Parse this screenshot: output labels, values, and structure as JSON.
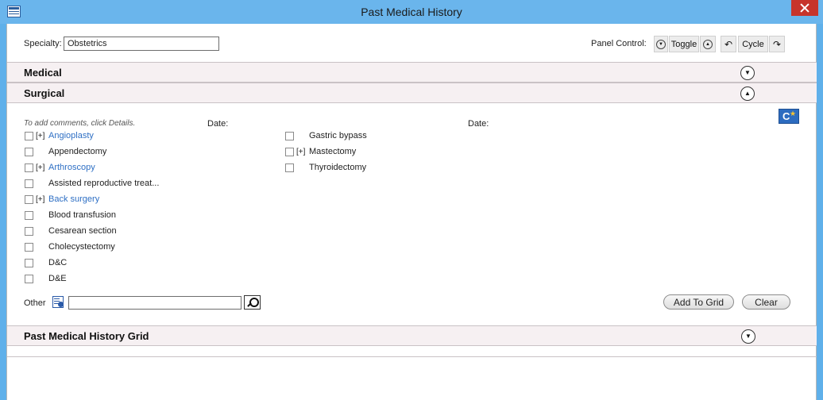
{
  "window": {
    "title": "Past Medical History"
  },
  "specialty": {
    "label": "Specialty:",
    "value": "Obstetrics"
  },
  "panel_control": {
    "label": "Panel Control:",
    "toggle_label": "Toggle",
    "cycle_label": "Cycle"
  },
  "sections": {
    "medical": {
      "title": "Medical"
    },
    "surgical": {
      "title": "Surgical"
    },
    "grid": {
      "title": "Past Medical History Grid"
    }
  },
  "surgical": {
    "hint": "To add comments, click Details.",
    "date_label": "Date:",
    "col1": [
      {
        "label": "Angioplasty",
        "expandable": true
      },
      {
        "label": "Appendectomy",
        "expandable": false
      },
      {
        "label": "Arthroscopy",
        "expandable": true
      },
      {
        "label": "Assisted reproductive treat...",
        "expandable": false
      },
      {
        "label": "Back surgery",
        "expandable": true
      },
      {
        "label": "Blood transfusion",
        "expandable": false
      },
      {
        "label": "Cesarean section",
        "expandable": false
      },
      {
        "label": "Cholecystectomy",
        "expandable": false
      },
      {
        "label": "D&C",
        "expandable": false
      },
      {
        "label": "D&E",
        "expandable": false
      }
    ],
    "col2": [
      {
        "label": "Gastric bypass",
        "expandable": false
      },
      {
        "label": "Mastectomy",
        "expandable": true
      },
      {
        "label": "Thyroidectomy",
        "expandable": false
      }
    ],
    "expander_text": "[+]",
    "other_label": "Other",
    "other_value": "",
    "add_to_grid_label": "Add To Grid",
    "clear_label": "Clear"
  }
}
